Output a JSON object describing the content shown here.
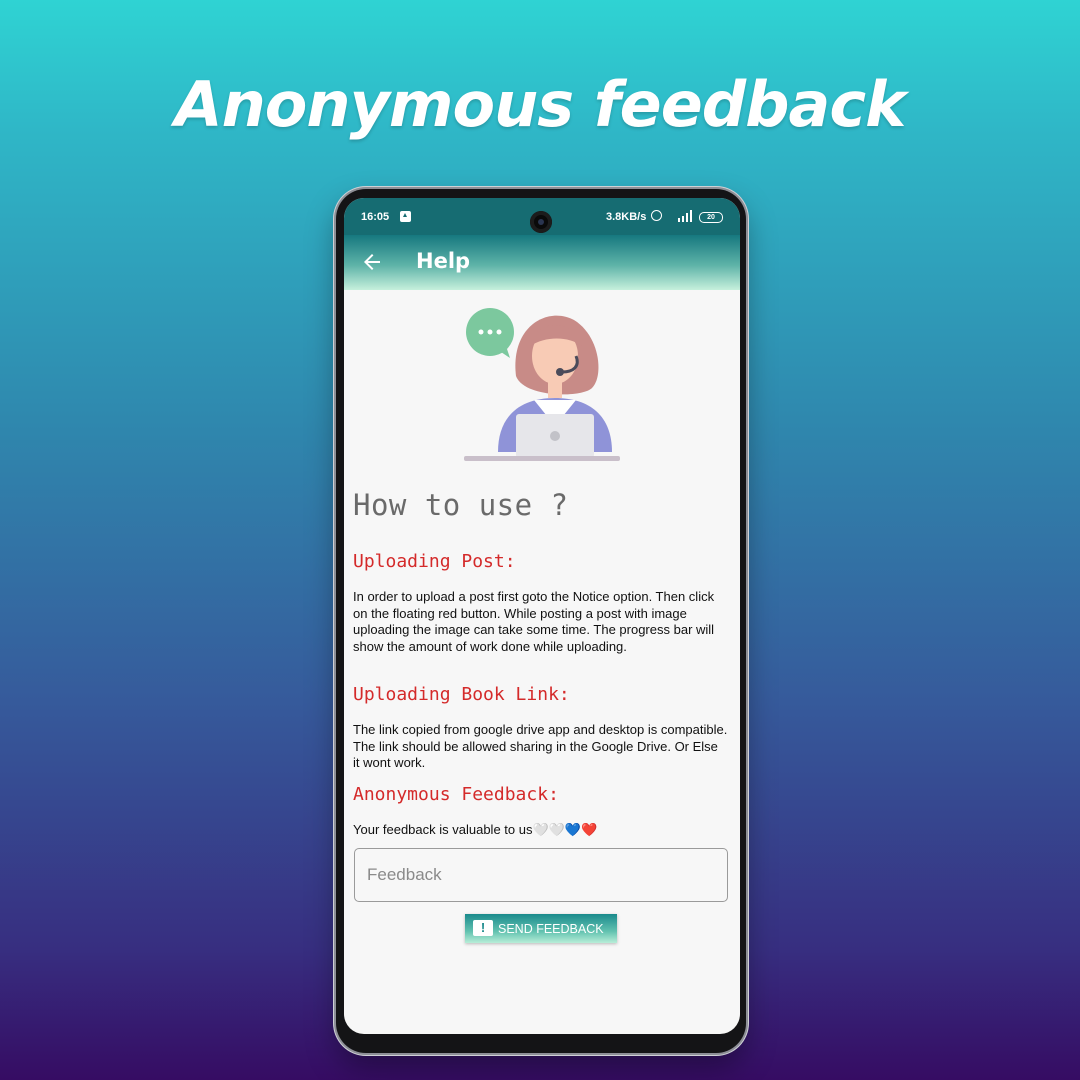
{
  "promo": {
    "title": "Anonymous feedback"
  },
  "status_bar": {
    "time": "16:05",
    "speed": "3.8KB/s",
    "battery": "20"
  },
  "app_bar": {
    "title": "Help",
    "back_icon": "arrow-back-icon"
  },
  "content": {
    "heading": "How to use ?",
    "sections": [
      {
        "title": "Uploading Post:",
        "text": "In order to upload a post first goto the Notice option. Then click on the floating red button. While posting a post with image uploading the image can take some time. The progress bar will show the amount of work done while uploading."
      },
      {
        "title": "Uploading Book Link:",
        "text": "The link copied from google drive app and desktop is compatible. The link should be allowed sharing in the Google Drive. Or Else it wont work."
      },
      {
        "title": "Anonymous Feedback:",
        "text": "Your feedback is valuable to us🤍🤍💙❤️"
      }
    ],
    "feedback_placeholder": "Feedback",
    "feedback_value": "",
    "send_button": "SEND FEEDBACK"
  },
  "colors": {
    "accent": "#d42a2a",
    "app_bar": "#16787f",
    "background_top": "#2fd3d3",
    "background_bottom": "#360c63"
  }
}
